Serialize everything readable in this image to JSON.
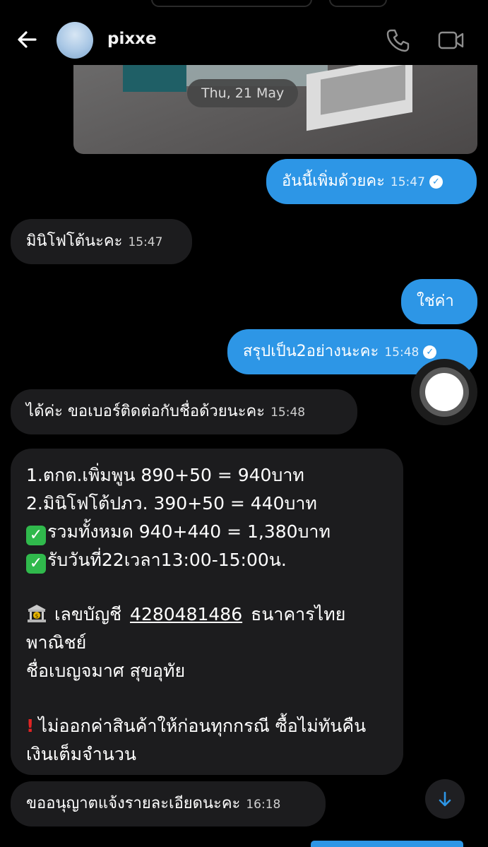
{
  "header": {
    "contact_name": "pixxe",
    "icons": [
      "back-arrow-icon",
      "phone-icon",
      "video-camera-icon"
    ]
  },
  "date_separator": "Thu, 21 May",
  "messages": [
    {
      "direction": "outgoing",
      "text": "อันนี้เพิ่มด้วยคะ",
      "time": "15:47",
      "read": true
    },
    {
      "direction": "incoming",
      "text": "มินิโฟโต้นะคะ",
      "time": "15:47"
    },
    {
      "direction": "outgoing",
      "text": "ใช่ค่า",
      "time": ""
    },
    {
      "direction": "outgoing",
      "text": "สรุปเป็น2อย่างนะคะ",
      "time": "15:48",
      "read": true
    },
    {
      "direction": "incoming",
      "text": "ได้ค่ะ ขอเบอร์ติดต่อกับชื่อด้วยนะคะ",
      "time": "15:48"
    },
    {
      "direction": "incoming",
      "time": "",
      "lines": {
        "l1": "1.ตกต.เพิ่มพูน 890+50 = 940บาท",
        "l2": "2.มินิโฟโต้ปภว. 390+50 = 440บาท",
        "l3": "รวมทั้งหมด 940+440 = 1,380บาท",
        "l4": "รับวันที่22เวลา13:00-15:00น.",
        "l5_prefix": "เลขบัญชี",
        "account_number": "4280481486",
        "l5_suffix": "ธนาคารไทย",
        "l6": "พาณิชย์",
        "l7": "ชื่อเบญจมาศ สุขอุทัย",
        "l8": "ไม่ออกค่าสินค้าให้ก่อนทุกกรณี ซื้อไม่ทันคืน",
        "l9": "เงินเต็มจำนวน"
      }
    },
    {
      "direction": "incoming",
      "text": "ขออนุญาตแจ้งรายละเอียดนะคะ",
      "time": "16:18"
    }
  ],
  "colors": {
    "outgoing_bubble": "#2d96e6",
    "incoming_bubble": "#1c1c1e",
    "background": "#000000",
    "check_emoji": "#30b94c",
    "exclamation": "#e02424"
  }
}
